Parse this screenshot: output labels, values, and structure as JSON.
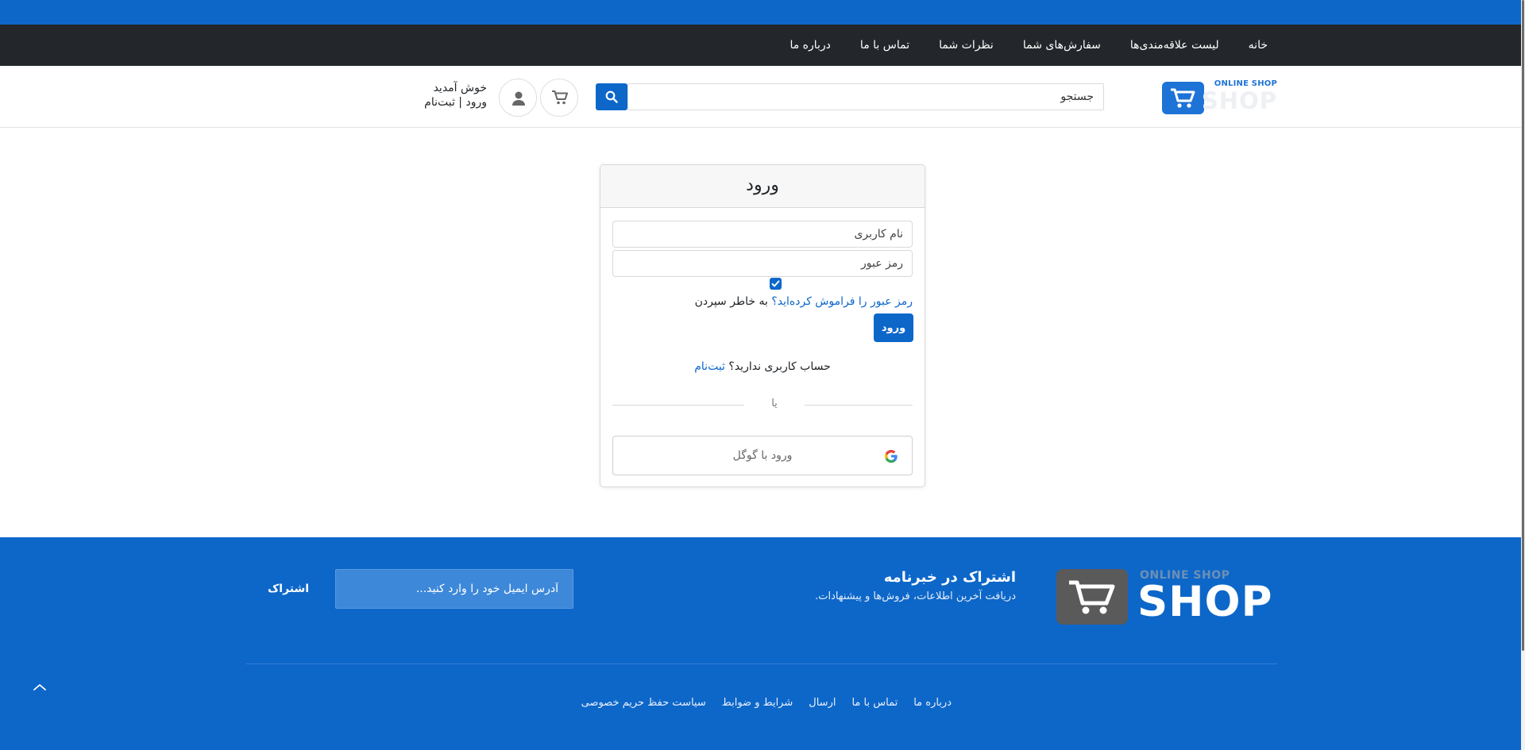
{
  "nav": {
    "items": [
      "خانه",
      "لیست علاقه‌مندی‌ها",
      "سفارش‌های شما",
      "نظرات شما",
      "تماس با ما",
      "درباره ما"
    ]
  },
  "header": {
    "logo_small": "ONLINE SHOP",
    "logo_big": "SHOP",
    "search_placeholder": "جستجو",
    "welcome": "خوش آمدید",
    "login_register": "ورود | ثبت‌نام"
  },
  "login": {
    "title": "ورود",
    "username_placeholder": "نام کاربری",
    "password_placeholder": "رمز عبور",
    "remember_checked": true,
    "forgot_link": "رمز عبور را فراموش کرده‌اید؟",
    "remember_label": "به خاطر سپردن",
    "submit_label": "ورود",
    "no_account_text": "حساب کاربری ندارید؟",
    "signup_link": "ثبت‌نام",
    "or_text": "یا",
    "google_label": "ورود با گوگل"
  },
  "footer": {
    "logo_small": "ONLINE SHOP",
    "logo_big": "SHOP",
    "newsletter_title": "اشتراک در خبرنامه",
    "newsletter_sub": "دریافت آخرین اطلاعات، فروش‌ها و پیشنهادات.",
    "email_placeholder": "آدرس ایمیل خود را وارد کنید...",
    "subscribe_label": "اشتراک",
    "links": [
      "درباره ما",
      "تماس با ما",
      "ارسال",
      "شرایط و ضوابط",
      "سیاست حفظ حریم خصوصی"
    ]
  },
  "colors": {
    "primary": "#0d67c9",
    "navbar": "#23262a",
    "footer_logo_box": "#5a5a5a"
  },
  "icons": [
    "cart-icon",
    "search-icon",
    "user-icon",
    "check-icon",
    "google-icon",
    "chevron-up-icon"
  ]
}
